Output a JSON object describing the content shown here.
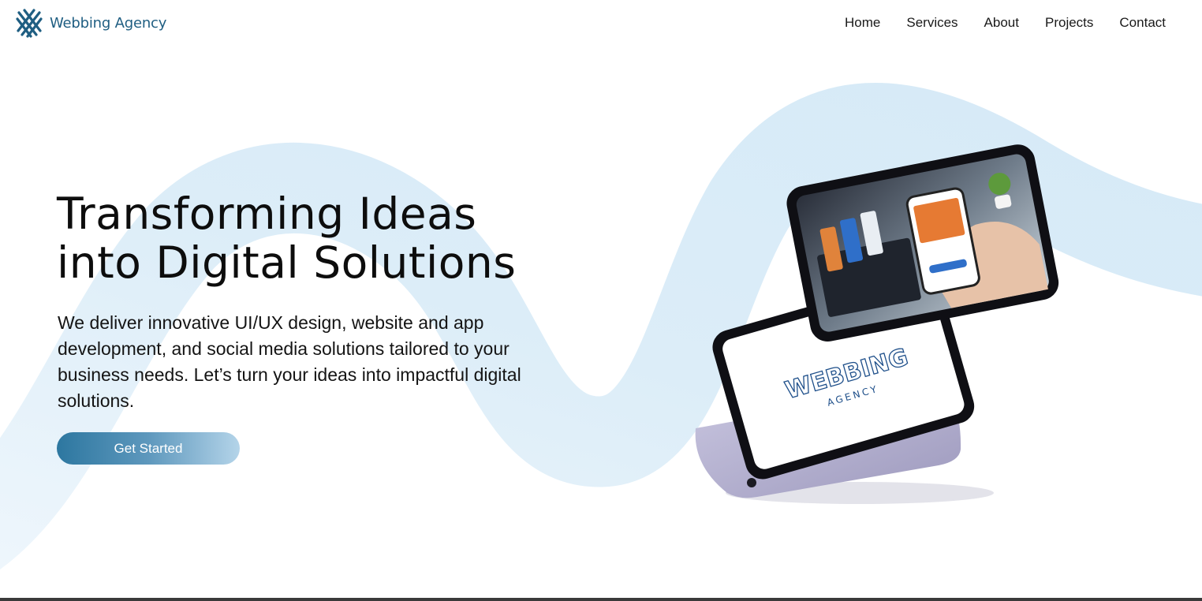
{
  "header": {
    "brand_name": "Webbing Agency",
    "nav": [
      "Home",
      "Services",
      "About",
      "Projects",
      "Contact"
    ]
  },
  "hero": {
    "title_line1": "Transforming Ideas",
    "title_line2": "into Digital Solutions",
    "description": "We deliver innovative UI/UX design, website and app development, and social media solutions tailored to your business needs. Let’s turn your ideas into impactful digital solutions.",
    "cta_label": "Get Started"
  },
  "illustration": {
    "logo_line1": "WEBBING",
    "logo_line2": "AGENCY",
    "icons": [
      "webbing-logo-icon",
      "tablet-illustration"
    ]
  },
  "colors": {
    "brand": "#1f5e82",
    "accent_wave": "#dcedf8",
    "button_start": "#2d77a0",
    "button_end": "#b4d4e9"
  }
}
